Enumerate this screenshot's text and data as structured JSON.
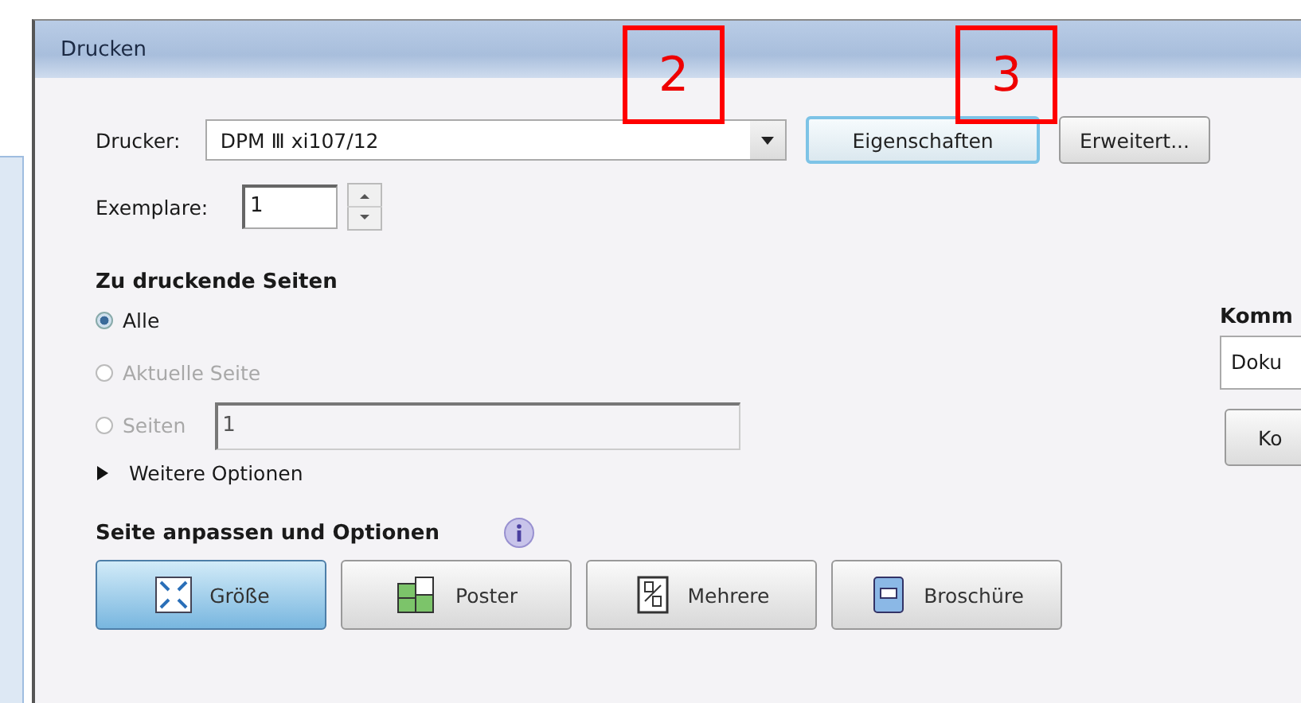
{
  "window": {
    "title": "Drucken"
  },
  "annotations": [
    {
      "label": "2"
    },
    {
      "label": "3"
    }
  ],
  "printer": {
    "label": "Drucker:",
    "value": "DPM Ⅲ xi107/12"
  },
  "printer_buttons": [
    {
      "label": "Eigenschaften",
      "focused": true
    },
    {
      "label": "Erweitert...",
      "focused": false
    }
  ],
  "copies": {
    "label": "Exemplare:",
    "value": "1"
  },
  "pages": {
    "heading": "Zu druckende Seiten",
    "options": [
      {
        "label": "Alle",
        "selected": true,
        "disabled": false
      },
      {
        "label": "Aktuelle Seite",
        "selected": false,
        "disabled": true
      },
      {
        "label": "Seiten",
        "selected": false,
        "disabled": true,
        "kind": "range",
        "value": "1"
      }
    ]
  },
  "more_options": {
    "label": "Weitere Optionen",
    "expanded": false
  },
  "fit": {
    "heading": "Seite anpassen und Optionen",
    "modes": [
      {
        "label": "Größe",
        "kind": "size",
        "selected": true
      },
      {
        "label": "Poster",
        "kind": "poster",
        "selected": false
      },
      {
        "label": "Mehrere",
        "kind": "multiple",
        "selected": false
      },
      {
        "label": "Broschüre",
        "kind": "booklet",
        "selected": false
      }
    ]
  },
  "comments": {
    "heading": "Komm",
    "value": "Doku",
    "button": "Ko"
  }
}
